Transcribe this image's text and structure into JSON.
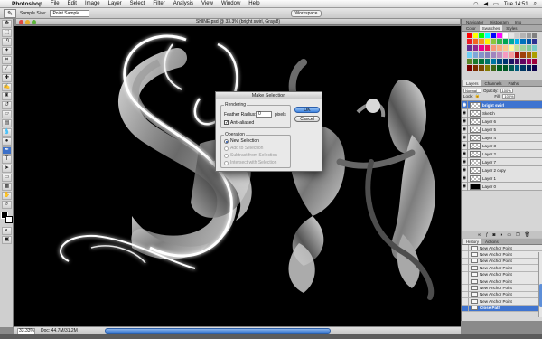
{
  "menubar": {
    "app_name": "Photoshop",
    "menus": [
      "File",
      "Edit",
      "Image",
      "Layer",
      "Select",
      "Filter",
      "Analysis",
      "View",
      "Window",
      "Help"
    ],
    "clock": "Tue 14:51"
  },
  "options_bar": {
    "sample_size_label": "Sample Size:",
    "sample_size_value": "Point Sample",
    "workspace_label": "Workspace"
  },
  "document": {
    "title": "SHINE.psd @ 33.3% (bright swirl, Gray/8)",
    "zoom": "33.33%",
    "doc_info": "Doc: 44.7M/31.2M"
  },
  "panels": {
    "top_tabs": [
      "Navigator",
      "Histogram",
      "Info"
    ],
    "swatch_tabs": [
      "Color",
      "Swatches",
      "Styles"
    ],
    "layers_tabs": [
      "Layers",
      "Channels",
      "Paths"
    ],
    "layers_options": {
      "blend_mode": "Normal",
      "opacity_label": "Opacity:",
      "opacity_value": "100%",
      "lock_label": "Lock:",
      "fill_label": "Fill:",
      "fill_value": "100%"
    },
    "layers": [
      {
        "name": "bright swirl",
        "selected": true,
        "thumb": "checker"
      },
      {
        "name": "Sketch",
        "selected": false,
        "thumb": "checker"
      },
      {
        "name": "Layer 6",
        "selected": false,
        "thumb": "checker"
      },
      {
        "name": "Layer 5",
        "selected": false,
        "thumb": "checker"
      },
      {
        "name": "Layer 4",
        "selected": false,
        "thumb": "checker"
      },
      {
        "name": "Layer 3",
        "selected": false,
        "thumb": "checker"
      },
      {
        "name": "Layer 2",
        "selected": false,
        "thumb": "checker"
      },
      {
        "name": "Layer 7",
        "selected": false,
        "thumb": "checker"
      },
      {
        "name": "Layer 2 copy",
        "selected": false,
        "thumb": "checker"
      },
      {
        "name": "Layer 1",
        "selected": false,
        "thumb": "checker"
      },
      {
        "name": "Layer 0",
        "selected": false,
        "thumb": "black"
      }
    ],
    "history_tabs": [
      "History",
      "Actions"
    ],
    "history": [
      {
        "name": "New Anchor Point",
        "selected": false
      },
      {
        "name": "New Anchor Point",
        "selected": false
      },
      {
        "name": "New Anchor Point",
        "selected": false
      },
      {
        "name": "New Anchor Point",
        "selected": false
      },
      {
        "name": "New Anchor Point",
        "selected": false
      },
      {
        "name": "New Anchor Point",
        "selected": false
      },
      {
        "name": "New Anchor Point",
        "selected": false
      },
      {
        "name": "New Anchor Point",
        "selected": false
      },
      {
        "name": "New Anchor Point",
        "selected": false
      },
      {
        "name": "Close Path",
        "selected": true
      }
    ]
  },
  "dialog": {
    "title": "Make Selection",
    "rendering_label": "Rendering",
    "feather_label": "Feather Radius:",
    "feather_value": "0",
    "feather_unit": "pixels",
    "anti_aliased_label": "Anti-aliased",
    "operation_label": "Operation",
    "operations": [
      "New Selection",
      "Add to Selection",
      "Subtract from Selection",
      "Intersect with Selection"
    ],
    "ok_label": "OK",
    "cancel_label": "Cancel"
  },
  "colors": {
    "selection_blue": "#3f74d0",
    "canvas_bg": "#000000"
  },
  "swatch_colors": [
    "#ff0000",
    "#ffff00",
    "#00ff00",
    "#00ffff",
    "#0000ff",
    "#ff00ff",
    "#ffffff",
    "#e6e6e6",
    "#cccccc",
    "#b3b3b3",
    "#999999",
    "#808080",
    "#ed1c24",
    "#f26522",
    "#f7941d",
    "#fff200",
    "#8dc63f",
    "#39b54a",
    "#00a651",
    "#00a99d",
    "#00aeef",
    "#0072bc",
    "#0054a6",
    "#2e3192",
    "#662d91",
    "#92278f",
    "#ec008c",
    "#ed145b",
    "#f7977a",
    "#fbad82",
    "#fdc68c",
    "#fff79a",
    "#c4df9b",
    "#a3d39c",
    "#82ca9c",
    "#7accc8",
    "#6dcff6",
    "#7da7d9",
    "#8393ca",
    "#8781bd",
    "#a186be",
    "#bd8cbf",
    "#f49ac1",
    "#f5989d",
    "#9e0b0f",
    "#a0410d",
    "#a36209",
    "#aba000",
    "#598527",
    "#1a7b30",
    "#007236",
    "#00746b",
    "#0076a3",
    "#004b80",
    "#003471",
    "#1b1464",
    "#440e62",
    "#630460",
    "#9e005d",
    "#9e0039",
    "#790000",
    "#7b2e00",
    "#7d4900",
    "#827b00",
    "#406618",
    "#005e20",
    "#005826",
    "#005952",
    "#005b7f",
    "#003663",
    "#002157",
    "#0d004c"
  ]
}
